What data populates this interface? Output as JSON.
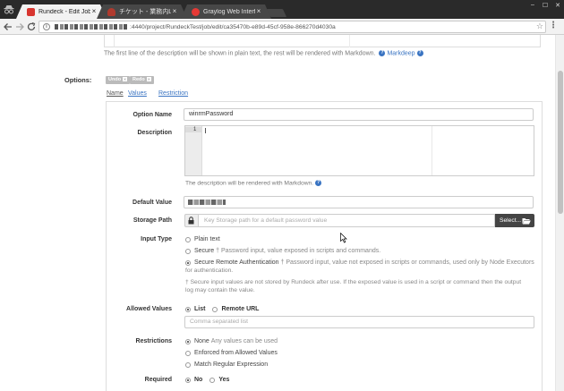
{
  "browser": {
    "tabs": [
      {
        "label": "Rundeck - Edit Job",
        "active": true,
        "favicon_color": "#d8352f"
      },
      {
        "label": "チケット - 業務内LAN運行",
        "active": false,
        "favicon_color": "#b03a2e"
      },
      {
        "label": "Graylog Web Interface",
        "active": false,
        "favicon_color": "#e53935"
      }
    ],
    "close_glyph": "×",
    "window_controls": [
      "–",
      "☐",
      "✕"
    ],
    "url_path": ":4440/project/RundeckTest/job/edit/ca35470b-e89d-45cf-958e-866270d4030a",
    "icons": {
      "back": "back-arrow-icon",
      "forward": "forward-arrow-icon",
      "reload": "reload-icon",
      "info": "info-icon",
      "star": "star-icon",
      "menu": "kebab-menu-icon",
      "incognito": "incognito-icon"
    }
  },
  "page": {
    "desc_help_prefix": "The first line of the description will be shown in plain text, the rest will be rendered with Markdown.",
    "markdeep_link": "Markdeep",
    "options_label": "Options:",
    "undo_label": "Undo",
    "redo_label": "Redo",
    "header_tabs": {
      "name": "Name",
      "values": "Values",
      "restriction": "Restriction"
    },
    "form": {
      "option_name_label": "Option Name",
      "option_name_value": "winrmPassword",
      "description_label": "Description",
      "editor_line_number": "1",
      "description_help": "The description will be rendered with Markdown.",
      "default_value_label": "Default Value",
      "storage_path_label": "Storage Path",
      "storage_path_placeholder": "Key Storage path for a default password value",
      "select_button": "Select...",
      "input_type_label": "Input Type",
      "input_types": {
        "plain": "Plain text",
        "secure": "Secure",
        "secure_desc": "† Password input, value exposed in scripts and commands.",
        "remote": "Secure Remote Authentication",
        "remote_desc_1": "† Password input, value not exposed in scripts or commands, used only by Node Executors",
        "remote_desc_2": "for authentication.",
        "selected": "remote"
      },
      "secure_note_1": "† Secure input values are not stored by Rundeck after use. If the exposed value is used in a script or command then the output",
      "secure_note_2": "log may contain the value.",
      "allowed_values_label": "Allowed Values",
      "allowed_values": {
        "list": "List",
        "remote_url": "Remote URL",
        "selected": "list"
      },
      "allowed_placeholder": "Comma separated list",
      "restrictions_label": "Restrictions",
      "restrictions": {
        "none": "None",
        "none_desc": "Any values can be used",
        "enforced": "Enforced from Allowed Values",
        "regex": "Match Regular Expression",
        "selected": "none"
      },
      "required_label": "Required",
      "required": {
        "no": "No",
        "yes": "Yes",
        "selected": "no"
      }
    }
  }
}
